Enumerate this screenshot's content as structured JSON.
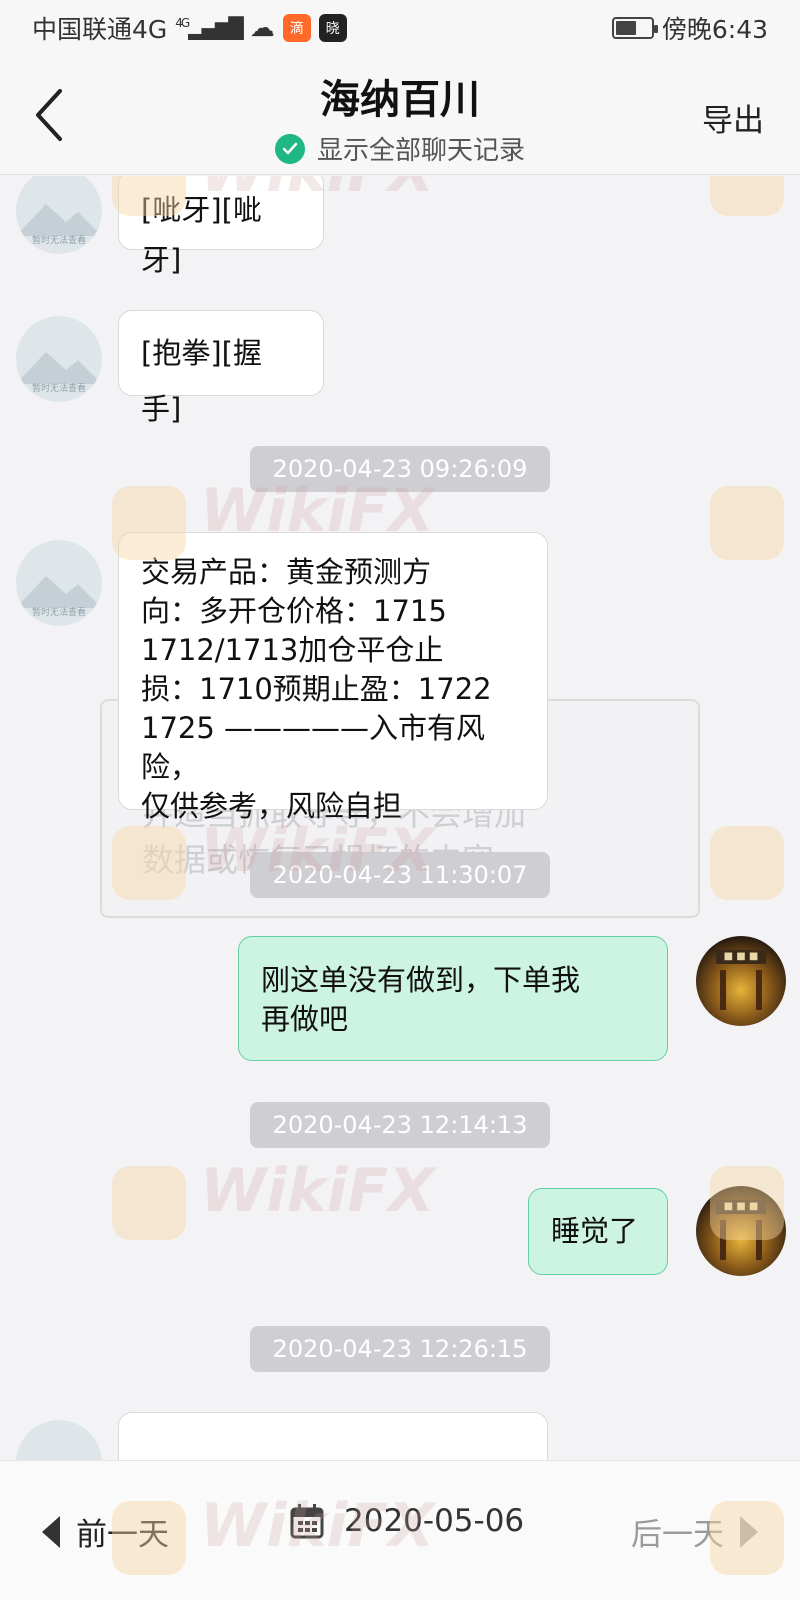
{
  "status_bar": {
    "carrier": "中国联通4G",
    "signal_badge": "4G",
    "time": "傍晚6:43",
    "battery_percent": 60,
    "app_badge_1": "滴",
    "app_badge_2": "晓"
  },
  "header": {
    "title": "海纳百川",
    "export_label": "导出",
    "show_all_label": "显示全部聊天记录"
  },
  "messages": [
    {
      "side": "left",
      "text": "[呲牙][呲牙]"
    },
    {
      "side": "left",
      "text": "[抱拳][握手]"
    },
    {
      "text": "2020-04-23 09:26:09"
    },
    {
      "side": "left",
      "lines": [
        "交易产品：黄金预测方",
        "向：多开仓价格：1715",
        "1712/1713加仓平仓止",
        "损：1710预期止盈：1722",
        "1725 —————入市有风险，",
        "仅供参考，风险自担"
      ]
    },
    {
      "text": "2020-04-23 11:30:07"
    },
    {
      "side": "right",
      "lines": [
        "刚这单没有做到，下单我",
        "再做吧"
      ]
    },
    {
      "text": "2020-04-23 12:14:13"
    },
    {
      "side": "right",
      "text": "睡觉了"
    },
    {
      "text": "2020-04-23 12:26:15"
    }
  ],
  "ghost_overlay": {
    "line1": "并适当抓取导导，不会增加",
    "line2": "数据或恢复已损坏的内容。"
  },
  "avatar_caption": "暂时无法查看",
  "watermark": "WikiFX",
  "bottom_bar": {
    "prev_label": "前一天",
    "date": "2020-05-06",
    "next_label": "后一天"
  },
  "colors": {
    "green_bubble": "#cdf3e3",
    "green_border": "#66cfa2",
    "check_green": "#1fb786",
    "timestamp_bg": "#cfcfd3"
  },
  "icons": [
    "back-chevron-icon",
    "check-circle-icon",
    "calendar-icon",
    "triangle-left-icon",
    "triangle-right-icon",
    "cloud-icon"
  ]
}
